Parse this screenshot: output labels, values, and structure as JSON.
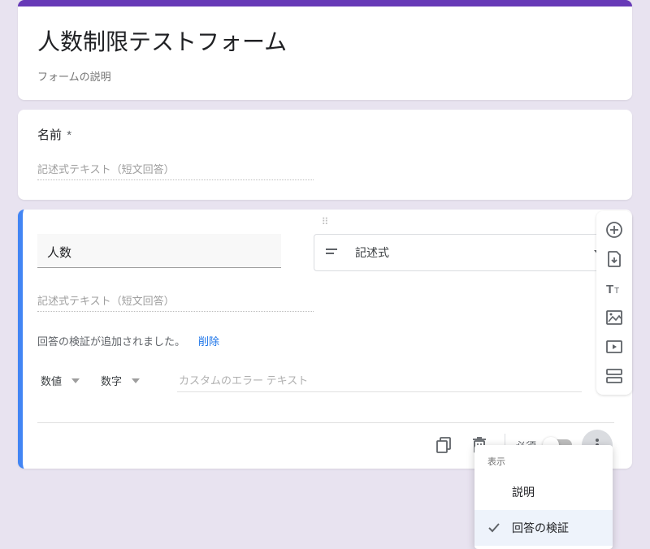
{
  "header": {
    "title": "人数制限テストフォーム",
    "description": "フォームの説明"
  },
  "q1": {
    "title": "名前",
    "required_mark": "*",
    "placeholder_text": "記述式テキスト（短文回答）"
  },
  "q2": {
    "title": "人数",
    "type_label": "記述式",
    "placeholder_text": "記述式テキスト（短文回答）",
    "validation_added": "回答の検証が追加されました。",
    "validation_delete": "削除",
    "val_type": "数値",
    "val_cond": "数字",
    "val_error_placeholder": "カスタムのエラー テキスト"
  },
  "footer": {
    "required_label": "必須"
  },
  "dropdown": {
    "header": "表示",
    "item_desc": "説明",
    "item_validation": "回答の検証"
  }
}
